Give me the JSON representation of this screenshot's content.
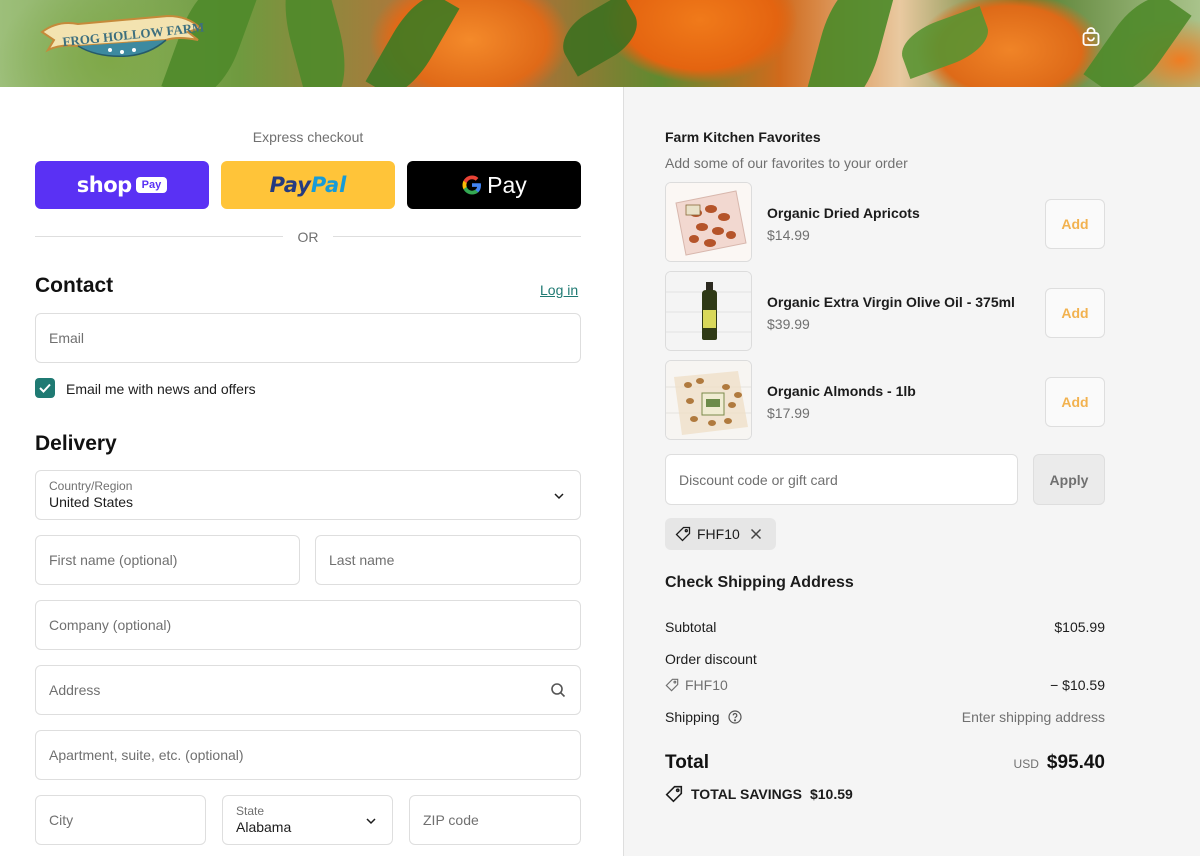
{
  "header": {
    "logo_text": "FROG HOLLOW FARM",
    "cart_icon": "shopping-bag-icon"
  },
  "express": {
    "label": "Express checkout",
    "shop_pay": {
      "word": "shop",
      "badge": "Pay"
    },
    "paypal": {
      "part1": "Pay",
      "part2": "Pal"
    },
    "gpay": {
      "g": "G",
      "word": "Pay"
    },
    "or": "OR"
  },
  "contact": {
    "title": "Contact",
    "login": "Log in",
    "email_placeholder": "Email",
    "newsletter_label": "Email me with news and offers",
    "newsletter_checked": true
  },
  "delivery": {
    "title": "Delivery",
    "country_label": "Country/Region",
    "country_value": "United States",
    "first_name_placeholder": "First name (optional)",
    "last_name_placeholder": "Last name",
    "company_placeholder": "Company (optional)",
    "address_placeholder": "Address",
    "apartment_placeholder": "Apartment, suite, etc. (optional)",
    "city_placeholder": "City",
    "state_label": "State",
    "state_value": "Alabama",
    "zip_placeholder": "ZIP code"
  },
  "upsell": {
    "title": "Farm Kitchen Favorites",
    "subtitle": "Add some of our favorites to your order",
    "products": [
      {
        "name": "Organic Dried Apricots",
        "price": "$14.99",
        "button": "Add"
      },
      {
        "name": "Organic Extra Virgin Olive Oil - 375ml",
        "price": "$39.99",
        "button": "Add"
      },
      {
        "name": "Organic Almonds - 1lb",
        "price": "$17.99",
        "button": "Add"
      }
    ]
  },
  "discount": {
    "placeholder": "Discount code or gift card",
    "apply": "Apply",
    "applied_code": "FHF10"
  },
  "summary": {
    "shipping_title": "Check Shipping Address",
    "subtotal_label": "Subtotal",
    "subtotal_value": "$105.99",
    "order_discount_label": "Order discount",
    "discount_code": "FHF10",
    "discount_value": "− $10.59",
    "shipping_label": "Shipping",
    "shipping_value": "Enter shipping address",
    "total_label": "Total",
    "total_currency": "USD",
    "total_value": "$95.40",
    "savings_label": "TOTAL SAVINGS",
    "savings_value": "$10.59"
  },
  "colors": {
    "accent": "#1f7a73",
    "shop_pay": "#5a31f4",
    "paypal": "#ffc439",
    "add_text": "#f2b24f"
  }
}
